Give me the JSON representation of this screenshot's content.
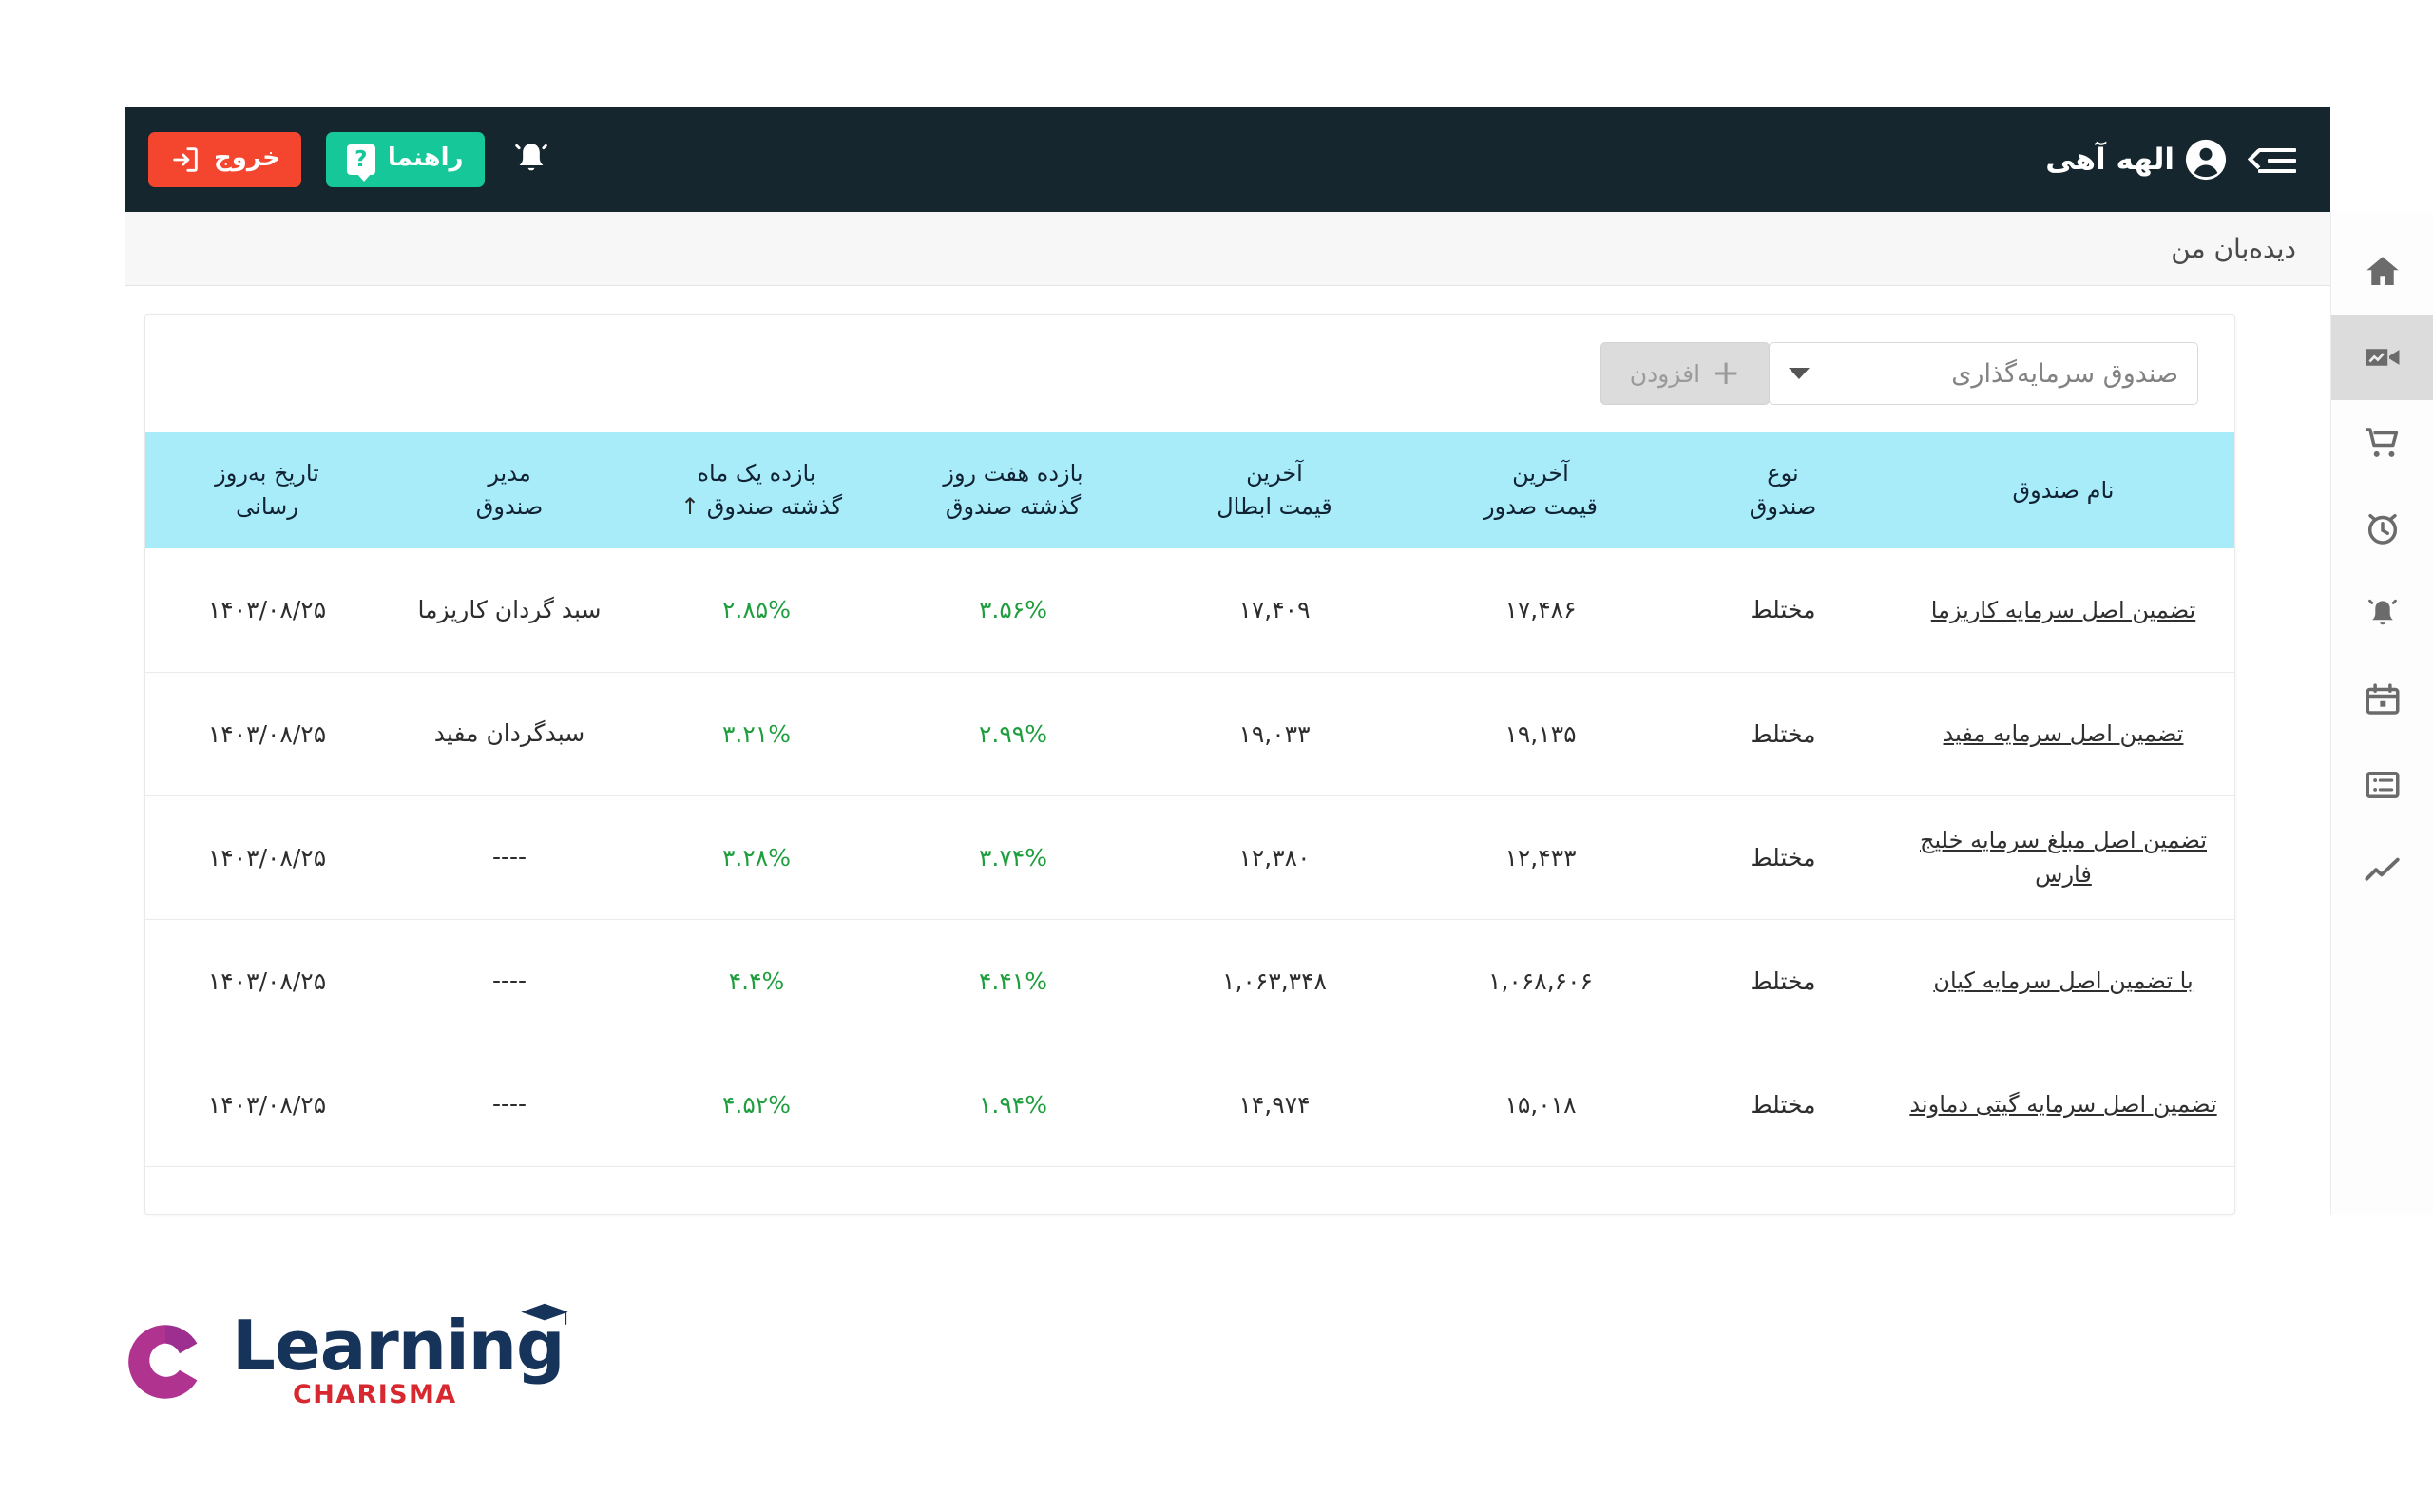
{
  "navbar": {
    "menu_icon": "hamburger-collapse-icon",
    "user_name": "الهه آهی",
    "avatar_icon": "user-circle-icon",
    "notification_icon": "bell-icon",
    "help_label": "راهنما",
    "help_icon": "question-mark-icon",
    "exit_label": "خروج",
    "exit_icon": "logout-icon",
    "colors": {
      "bg": "#16262f",
      "help_bg": "#16c79a",
      "exit_bg": "#f4452f"
    }
  },
  "subheader": {
    "page_title": "دیده‌بان من"
  },
  "rail": {
    "items": [
      {
        "icon": "home-icon",
        "active": false
      },
      {
        "icon": "video-camera-chart-icon",
        "active": true
      },
      {
        "icon": "shopping-cart-icon",
        "active": false
      },
      {
        "icon": "alarm-clock-icon",
        "active": false
      },
      {
        "icon": "bell-icon",
        "active": false
      },
      {
        "icon": "calendar-icon",
        "active": false
      },
      {
        "icon": "list-icon",
        "active": false
      },
      {
        "icon": "line-chart-icon",
        "active": false
      }
    ]
  },
  "toolbar": {
    "select_value": "صندوق سرمایه‌گذاری",
    "select_caret_icon": "chevron-down-icon",
    "add_label": "افزودن",
    "add_icon": "plus-icon",
    "add_disabled": true
  },
  "table": {
    "header_bg": "#a8ecfa",
    "sort_arrow": "↑",
    "columns": [
      {
        "label": "نام صندوق",
        "key": "name"
      },
      {
        "label": "نوع\nصندوق",
        "line1": "نوع",
        "line2": "صندوق"
      },
      {
        "line1": "آخرین",
        "line2": "قیمت صدور"
      },
      {
        "line1": "آخرین",
        "line2": "قیمت ابطال"
      },
      {
        "line1": "بازده هفت روز",
        "line2": "گذشته صندوق"
      },
      {
        "line1": "بازده یک ماه",
        "line2": "گذشته صندوق",
        "sorted": true
      },
      {
        "line1": "مدیر",
        "line2": "صندوق"
      },
      {
        "line1": "تاریخ به‌روز",
        "line2": "رسانی"
      }
    ],
    "row_icons": {
      "delete": "trash-icon",
      "add_alarm": "alarm-clock-plus-icon"
    },
    "rows": [
      {
        "name": "تضمین اصل سرمایه کاریزما",
        "type": "مختلط",
        "issue_price": "۱۷,۴۸۶",
        "cancel_price": "۱۷,۴۰۹",
        "return_7d": "۳.۵۶%",
        "return_30d": "۲.۸۵%",
        "manager": "سبد گردان کاریزما",
        "updated": "۱۴۰۳/۰۸/۲۵"
      },
      {
        "name": "تضمین اصل سرمایه مفید",
        "type": "مختلط",
        "issue_price": "۱۹,۱۳۵",
        "cancel_price": "۱۹,۰۳۳",
        "return_7d": "۲.۹۹%",
        "return_30d": "۳.۲۱%",
        "manager": "سبدگردان مفید",
        "updated": "۱۴۰۳/۰۸/۲۵"
      },
      {
        "name": "تضمین اصل مبلغ سرمایه خلیج فارس",
        "type": "مختلط",
        "issue_price": "۱۲,۴۳۳",
        "cancel_price": "۱۲,۳۸۰",
        "return_7d": "۳.۷۴%",
        "return_30d": "۳.۲۸%",
        "manager": "----",
        "updated": "۱۴۰۳/۰۸/۲۵"
      },
      {
        "name": "با تضمین اصل سرمایه کیان",
        "type": "مختلط",
        "issue_price": "۱,۰۶۸,۶۰۶",
        "cancel_price": "۱,۰۶۳,۳۴۸",
        "return_7d": "۴.۴۱%",
        "return_30d": "۴.۴%",
        "manager": "----",
        "updated": "۱۴۰۳/۰۸/۲۵"
      },
      {
        "name": "تضمین اصل سرمایه گیتی دماوند",
        "type": "مختلط",
        "issue_price": "۱۵,۰۱۸",
        "cancel_price": "۱۴,۹۷۴",
        "return_7d": "۱.۹۴%",
        "return_30d": "۴.۵۲%",
        "manager": "----",
        "updated": "۱۴۰۳/۰۸/۲۵"
      }
    ],
    "positive_color": "#1f9e3e"
  },
  "footer": {
    "logo_word": "Learning",
    "logo_sub": "CHARISMA",
    "mark_icon": "charisma-circle-mark-icon",
    "cap_icon": "graduation-cap-icon",
    "colors": {
      "word": "#16335a",
      "sub": "#d7272f",
      "mark": "#b0338f"
    }
  }
}
